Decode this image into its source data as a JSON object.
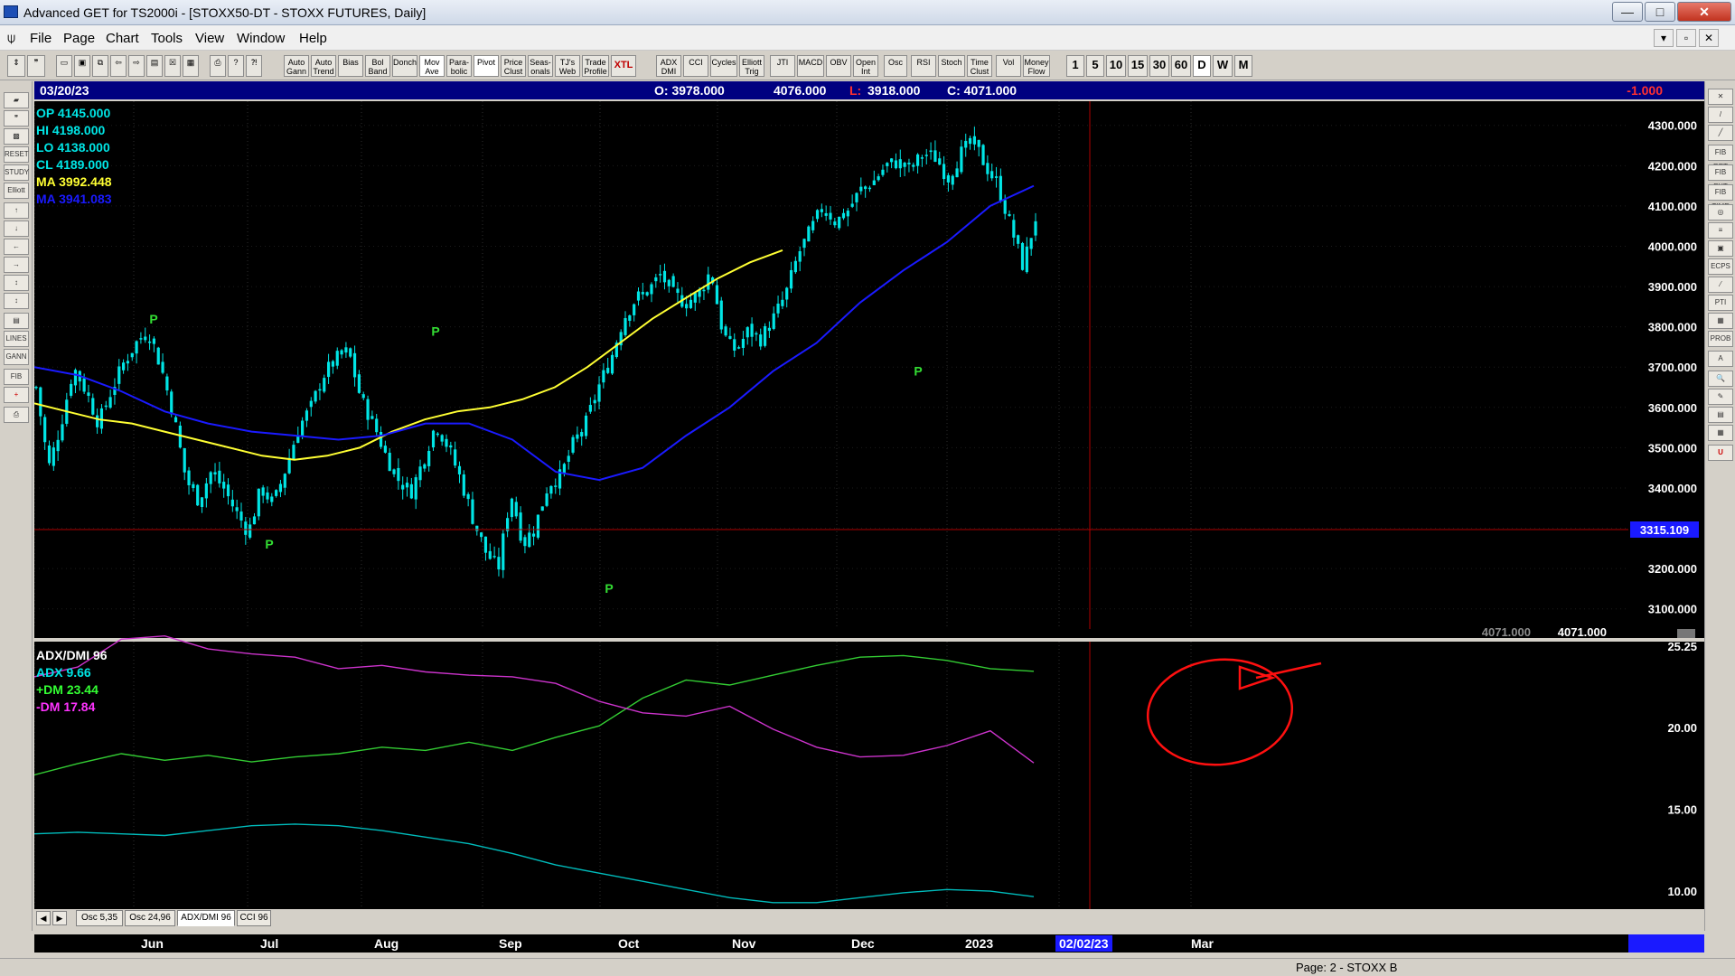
{
  "window": {
    "title": "Advanced GET for TS2000i - [STOXX50-DT - STOXX FUTURES, Daily]",
    "minimize": "—",
    "maximize": "□",
    "close": "✕"
  },
  "menu": {
    "items": [
      "File",
      "Page",
      "Chart",
      "Tools",
      "View",
      "Window",
      "Help"
    ],
    "mdi_buttons": [
      "▾",
      "▫",
      "✕"
    ]
  },
  "toolbar": {
    "study_buttons": [
      "Auto Gann",
      "Auto Trend",
      "Bias",
      "Bol Band",
      "Donch",
      "Mov Ave",
      "Para- bolic",
      "Pivot",
      "Price Clust",
      "Seas- onals",
      "TJ's Web",
      "Trade Profile"
    ],
    "xtl_label": "XTL",
    "indicator_buttons": [
      "ADX DMI",
      "CCI",
      "Cycles",
      "Elliott Trig",
      "JTI",
      "MACD",
      "OBV",
      "Open Int",
      "Osc",
      "RSI",
      "Stoch",
      "Time Clust",
      "Vol",
      "Money Flow"
    ],
    "interval_buttons": [
      "1",
      "5",
      "10",
      "15",
      "30",
      "60",
      "D",
      "W",
      "M"
    ]
  },
  "left_tools": [
    "open",
    "99",
    "",
    "RESET",
    "STUDY",
    "Elliott",
    "↑",
    "↓",
    "←",
    "→",
    "↕",
    "↕",
    "▤",
    "LINES",
    "GANN",
    "FIB",
    "+",
    "print"
  ],
  "right_tools": [
    "✕",
    "/",
    "╱",
    "FIB RET",
    "FIB EXT",
    "FIB TIME",
    "◎",
    "≡",
    "▣",
    "ECPS",
    "⁄",
    "PTI",
    "▦",
    "PROB",
    "A",
    "🔍",
    "✎",
    "▤",
    "▦",
    "U"
  ],
  "info_bar": {
    "date": "03/20/23",
    "open": "O: 3978.000",
    "high": "4076.000",
    "low_label": "L:",
    "low": "3918.000",
    "close": "C: 4071.000",
    "change": "-1.000"
  },
  "price_legend": [
    {
      "label": "OP",
      "value": "4145.000",
      "color": "#00e5e5"
    },
    {
      "label": "HI",
      "value": "4198.000",
      "color": "#00e5e5"
    },
    {
      "label": "LO",
      "value": "4138.000",
      "color": "#00e5e5"
    },
    {
      "label": "CL",
      "value": "4189.000",
      "color": "#00e5e5"
    },
    {
      "label": "MA",
      "value": "3992.448",
      "color": "#ffff33"
    },
    {
      "label": "MA",
      "value": "3941.083",
      "color": "#1a1aff"
    }
  ],
  "price_axis_labels": [
    "4300.000",
    "4200.000",
    "4100.000",
    "4000.000",
    "3900.000",
    "3800.000",
    "3700.000",
    "3600.000",
    "3500.000",
    "3400.000",
    "3300.000",
    "3200.000",
    "3100.000"
  ],
  "crosshair_price": "3315.109",
  "last_close_left": "4071.000",
  "last_close_right": "4071.000",
  "pivot_marker": "P",
  "indicator_legend": [
    {
      "label": "ADX/DMI 96",
      "color": "#ffffff"
    },
    {
      "label": "ADX 9.66",
      "color": "#00e5e5"
    },
    {
      "label": "+DM 23.44",
      "color": "#33ff33"
    },
    {
      "label": "-DM  17.84",
      "color": "#ff33ff"
    }
  ],
  "indicator_axis_labels": [
    "25.25",
    "20.00",
    "15.00",
    "10.00"
  ],
  "date_axis_labels": [
    "Jun",
    "Jul",
    "Aug",
    "Sep",
    "Oct",
    "Nov",
    "Dec",
    "2023",
    "Mar"
  ],
  "date_cursor_label": "02/02/23",
  "tabs": [
    "Osc 5,35",
    "Osc 24,96",
    "ADX/DMI 96",
    "CCI 96"
  ],
  "tab_nav": [
    "◀",
    "▶"
  ],
  "status": {
    "page": "Page: 2 - STOXX B"
  },
  "colors": {
    "background": "#000000",
    "info_bar": "#000080",
    "candles": "#00e5e5",
    "ma_fast": "#ffff33",
    "ma_slow": "#1a1aff",
    "crosshair": "#b00000",
    "pivot": "#33dd33",
    "plus_dm": "#33cc33",
    "minus_dm": "#cc33cc",
    "adx": "#00bbbb",
    "annotation": "#ff1010"
  },
  "chart_data": [
    {
      "type": "candlestick",
      "title": "STOXX50-DT - STOXX FUTURES, Daily",
      "ylim": [
        3050,
        4360
      ],
      "yticks": [
        4300,
        4200,
        4100,
        4000,
        3900,
        3800,
        3700,
        3600,
        3500,
        3400,
        3300,
        3200,
        3100
      ],
      "x_labels": [
        "Jun",
        "Jul",
        "Aug",
        "Sep",
        "Oct",
        "Nov",
        "Dec",
        "2023",
        "Mar"
      ],
      "close_path": [
        3650,
        3450,
        3560,
        3700,
        3640,
        3560,
        3640,
        3710,
        3760,
        3790,
        3700,
        3580,
        3420,
        3370,
        3440,
        3400,
        3340,
        3290,
        3400,
        3360,
        3450,
        3550,
        3600,
        3680,
        3720,
        3740,
        3620,
        3560,
        3480,
        3420,
        3390,
        3470,
        3560,
        3500,
        3420,
        3320,
        3240,
        3200,
        3390,
        3260,
        3310,
        3410,
        3430,
        3510,
        3560,
        3650,
        3720,
        3820,
        3870,
        3890,
        3930,
        3880,
        3860,
        3880,
        3940,
        3780,
        3740,
        3790,
        3770,
        3820,
        3880,
        3980,
        4040,
        4100,
        4060,
        4090,
        4140,
        4160,
        4200,
        4210,
        4190,
        4230,
        4220,
        4170,
        4230,
        4260,
        4200,
        4150,
        4050,
        3950,
        4071
      ],
      "pivots": [
        {
          "label": "P",
          "high": true,
          "value": 3790
        },
        {
          "label": "P",
          "high": false,
          "value": 3290
        },
        {
          "label": "P",
          "high": true,
          "value": 3760
        },
        {
          "label": "P",
          "high": false,
          "value": 3180
        },
        {
          "label": "P",
          "high": false,
          "value": 3720
        }
      ],
      "series": [
        {
          "name": "MA 3992.448",
          "values": [
            3610,
            3590,
            3570,
            3560,
            3540,
            3520,
            3500,
            3480,
            3470,
            3480,
            3500,
            3540,
            3570,
            3590,
            3600,
            3620,
            3650,
            3700,
            3760,
            3820,
            3870,
            3920,
            3960,
            3990
          ]
        },
        {
          "name": "MA 3941.083",
          "values": [
            3700,
            3680,
            3640,
            3590,
            3560,
            3540,
            3530,
            3520,
            3530,
            3560,
            3560,
            3520,
            3440,
            3420,
            3450,
            3530,
            3600,
            3690,
            3760,
            3860,
            3940,
            4010,
            4100,
            4150
          ]
        }
      ],
      "crosshair": {
        "price": 3315.109,
        "date": "02/02/23"
      }
    },
    {
      "type": "line",
      "title": "ADX/DMI 96",
      "ylim": [
        8.9,
        25.25
      ],
      "yticks": [
        25.25,
        20.0,
        15.0,
        10.0
      ],
      "series": [
        {
          "name": "ADX 9.66",
          "values": [
            13.5,
            13.6,
            13.5,
            13.4,
            13.7,
            14.0,
            14.1,
            14.0,
            13.7,
            13.3,
            12.9,
            12.3,
            11.6,
            11.1,
            10.6,
            10.1,
            9.6,
            9.3,
            9.3,
            9.6,
            9.9,
            10.1,
            10.0,
            9.66
          ]
        },
        {
          "name": "+DM 23.44",
          "values": [
            17.1,
            17.8,
            18.4,
            18.0,
            18.3,
            17.9,
            18.2,
            18.4,
            18.8,
            18.6,
            19.1,
            18.6,
            19.4,
            20.1,
            21.8,
            22.9,
            22.6,
            23.2,
            23.8,
            24.3,
            24.4,
            24.1,
            23.6,
            23.44
          ]
        },
        {
          "name": "-DM  17.84",
          "values": [
            23.1,
            23.7,
            25.4,
            25.6,
            24.8,
            24.5,
            24.3,
            23.6,
            23.8,
            23.4,
            23.2,
            23.1,
            22.7,
            21.6,
            20.9,
            20.7,
            21.3,
            19.9,
            18.8,
            18.2,
            18.3,
            18.9,
            19.8,
            17.84
          ]
        }
      ]
    }
  ]
}
